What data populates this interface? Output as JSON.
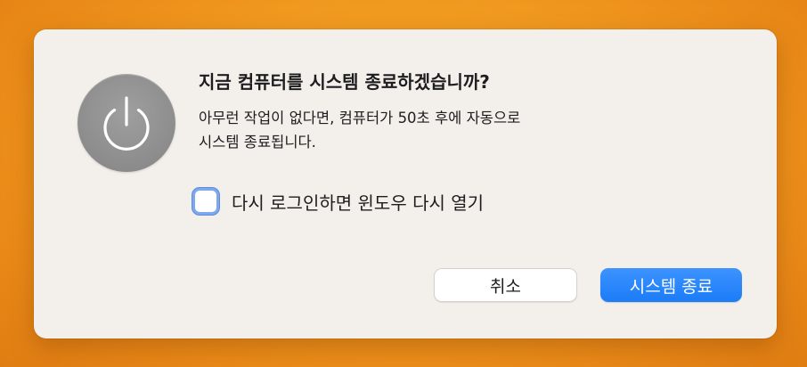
{
  "dialog": {
    "title": "지금 컴퓨터를 시스템 종료하겠습니까?",
    "message_line1": "아무런 작업이 없다면, 컴퓨터가 50초 후에 자동으로",
    "message_line2": "시스템 종료됩니다.",
    "icon": "power-icon",
    "countdown_seconds": 50,
    "checkbox": {
      "label": "다시 로그인하면 윈도우 다시 열기",
      "checked": false
    },
    "buttons": {
      "cancel_label": "취소",
      "shutdown_label": "시스템 종료"
    }
  },
  "colors": {
    "background": "#f19a20",
    "dialog": "#f3efea",
    "accent": "#1b7cf7",
    "icon": "#8c8c8c"
  }
}
